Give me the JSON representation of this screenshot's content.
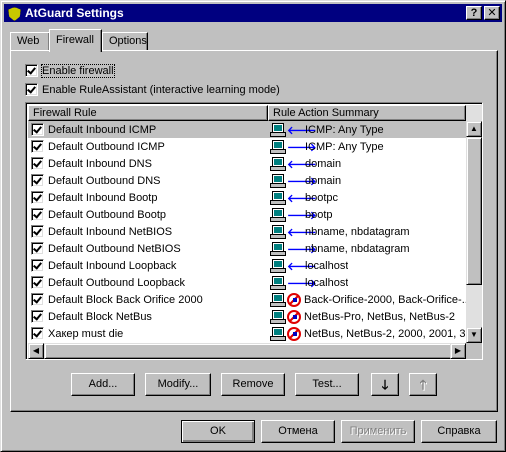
{
  "window": {
    "title": "AtGuard Settings",
    "help_glyph": "?",
    "close_glyph": "✕"
  },
  "tabs": [
    {
      "label": "Web"
    },
    {
      "label": "Firewall"
    },
    {
      "label": "Options"
    }
  ],
  "firewall": {
    "enable_firewall": {
      "label": "Enable firewall",
      "checked": true
    },
    "enable_ruleassistant": {
      "label": "Enable RuleAssistant (interactive learning mode)",
      "checked": true
    },
    "columns": [
      "Firewall Rule",
      "Rule Action Summary"
    ],
    "rules": [
      {
        "name": "Default Inbound ICMP",
        "direction": "in",
        "summary": "ICMP: Any Type",
        "checked": true,
        "blocked": false
      },
      {
        "name": "Default Outbound ICMP",
        "direction": "out",
        "summary": "ICMP: Any Type",
        "checked": true,
        "blocked": false
      },
      {
        "name": "Default Inbound DNS",
        "direction": "in",
        "summary": "domain",
        "checked": true,
        "blocked": false
      },
      {
        "name": "Default Outbound DNS",
        "direction": "out",
        "summary": "domain",
        "checked": true,
        "blocked": false
      },
      {
        "name": "Default Inbound Bootp",
        "direction": "in",
        "summary": "bootpc",
        "checked": true,
        "blocked": false
      },
      {
        "name": "Default Outbound Bootp",
        "direction": "out",
        "summary": "bootp",
        "checked": true,
        "blocked": false
      },
      {
        "name": "Default Inbound NetBIOS",
        "direction": "in",
        "summary": "nbname, nbdatagram",
        "checked": true,
        "blocked": false
      },
      {
        "name": "Default Outbound NetBIOS",
        "direction": "out",
        "summary": "nbname, nbdatagram",
        "checked": true,
        "blocked": false
      },
      {
        "name": "Default Inbound Loopback",
        "direction": "in",
        "summary": "localhost",
        "checked": true,
        "blocked": false
      },
      {
        "name": "Default Outbound Loopback",
        "direction": "out",
        "summary": "localhost",
        "checked": true,
        "blocked": false
      },
      {
        "name": "Default Block Back Orifice 2000",
        "direction": "in",
        "summary": "Back-Orifice-2000, Back-Orifice-...",
        "checked": true,
        "blocked": true
      },
      {
        "name": "Default Block NetBus",
        "direction": "in",
        "summary": "NetBus-Pro, NetBus, NetBus-2",
        "checked": true,
        "blocked": true
      },
      {
        "name": "Хакер must die",
        "direction": "in",
        "summary": "NetBus, NetBus-2, 2000, 2001, 3...",
        "checked": true,
        "blocked": true
      }
    ],
    "buttons": {
      "add": "Add...",
      "modify": "Modify...",
      "remove": "Remove",
      "test": "Test..."
    }
  },
  "dialog_buttons": {
    "ok": "OK",
    "cancel": "Отмена",
    "apply": "Применить",
    "help": "Справка"
  },
  "icons": {
    "inbound_arrow": "🡐",
    "outbound_arrow": "🡒",
    "move_down": "🡓",
    "move_up": "🡑"
  }
}
